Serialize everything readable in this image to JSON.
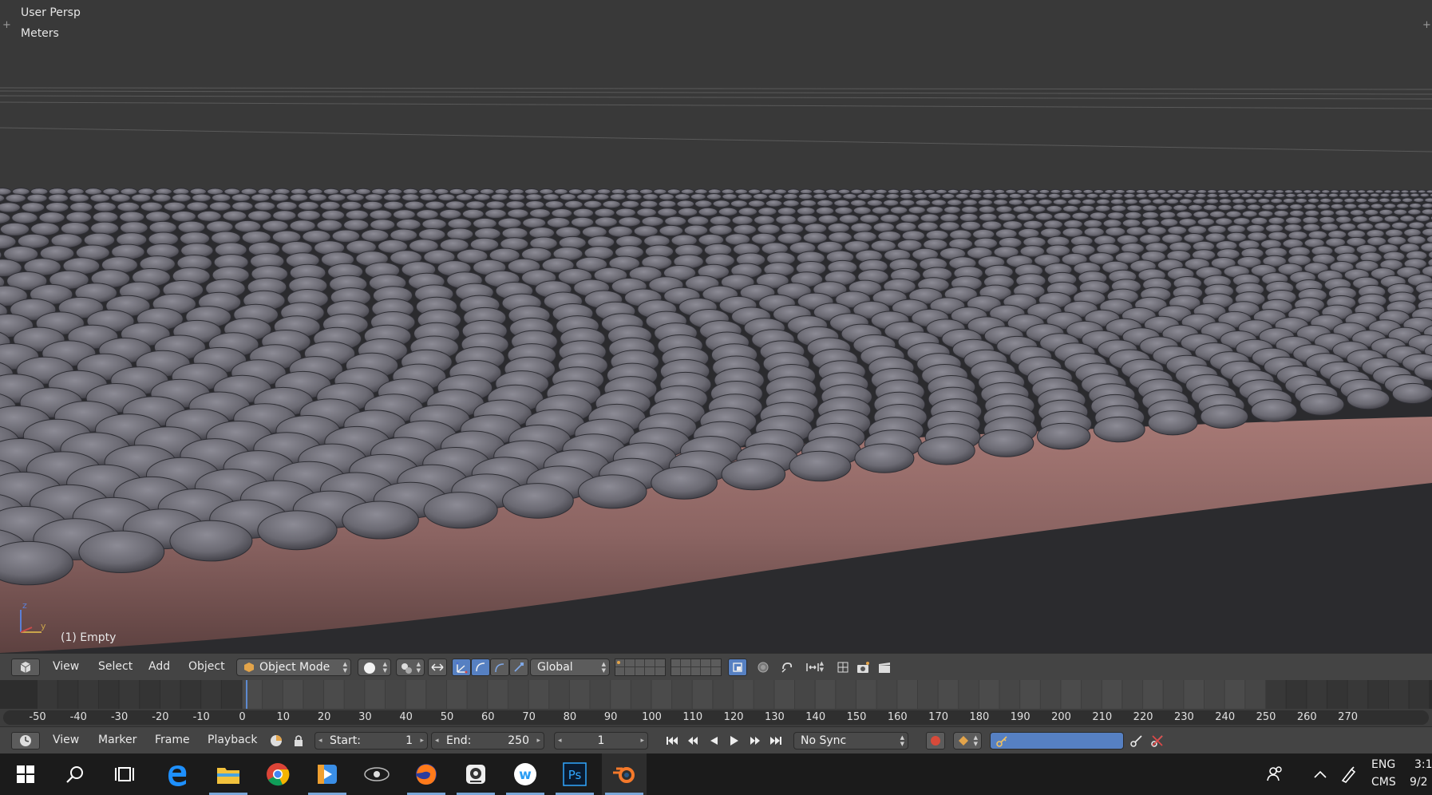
{
  "viewport": {
    "view_label": "User Persp",
    "units_label": "Meters",
    "object_label": "(1) Empty",
    "axis_z": "z",
    "axis_y": "y",
    "colors": {
      "background": "#393939",
      "scales": "#6b6a73",
      "tube": "#8b6462"
    }
  },
  "header": {
    "menu": [
      "View",
      "Select",
      "Add",
      "Object"
    ],
    "mode": "Object Mode",
    "orientation": "Global"
  },
  "timeline": {
    "ticks": [
      "-50",
      "-40",
      "-30",
      "-20",
      "-10",
      "0",
      "10",
      "20",
      "30",
      "40",
      "50",
      "60",
      "70",
      "80",
      "90",
      "100",
      "110",
      "120",
      "130",
      "140",
      "150",
      "160",
      "170",
      "180",
      "190",
      "200",
      "210",
      "220",
      "230",
      "240",
      "250",
      "260",
      "270"
    ],
    "current_frame_value": 1
  },
  "timeline_header": {
    "menu": [
      "View",
      "Marker",
      "Frame",
      "Playback"
    ],
    "start_label": "Start:",
    "start_value": "1",
    "end_label": "End:",
    "end_value": "250",
    "current_frame": "1",
    "sync": "No Sync"
  },
  "taskbar": {
    "apps": [
      "windows-start",
      "search",
      "task-view",
      "edge",
      "file-explorer",
      "chrome",
      "media-player",
      "gear-app",
      "firefox",
      "camera-app",
      "w-app",
      "photoshop",
      "blender"
    ],
    "language_top": "ENG",
    "language_bottom": "CMS",
    "time": "3:1",
    "date": "9/2"
  }
}
